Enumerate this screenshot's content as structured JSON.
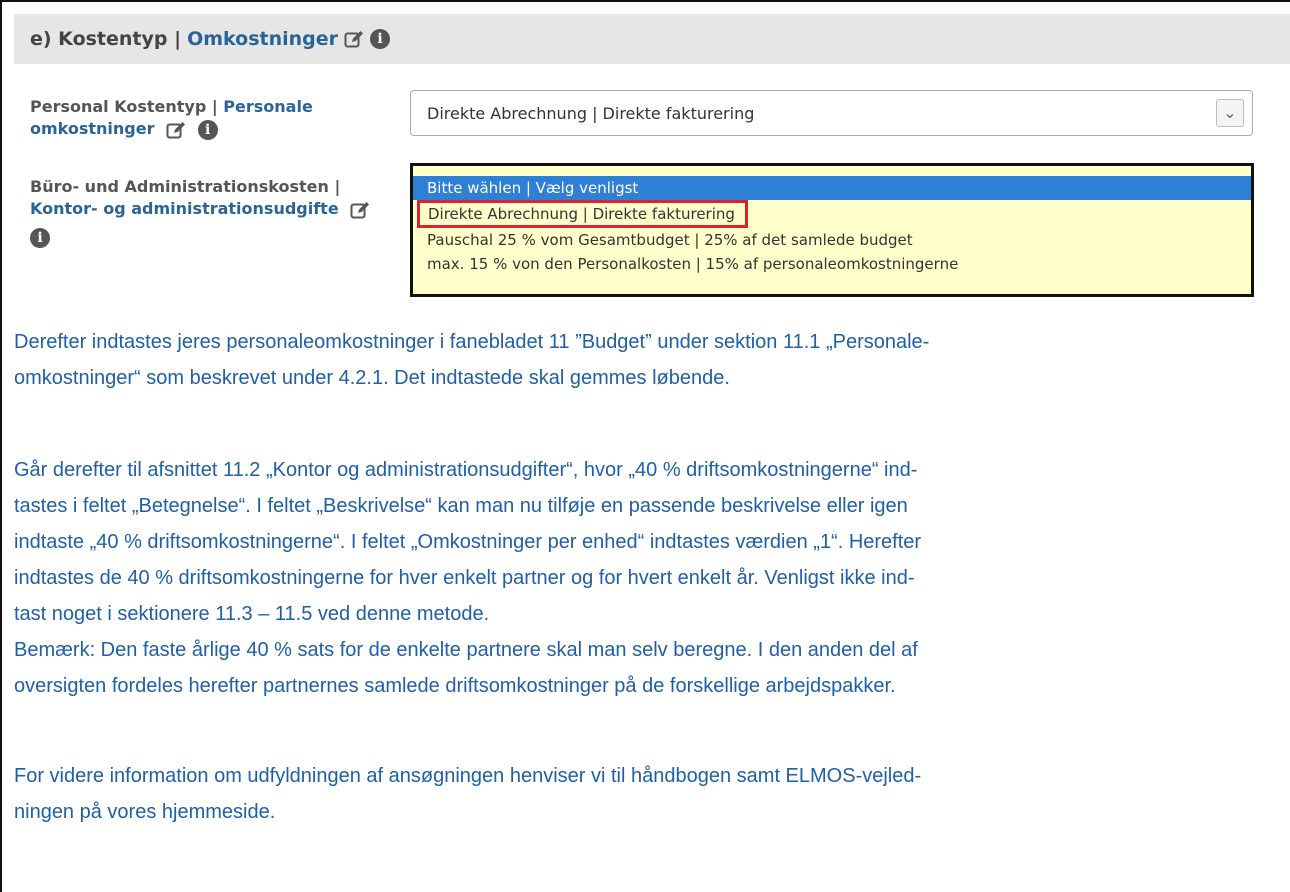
{
  "header": {
    "prefix": "e) Kostentyp |",
    "link": "Omkostninger"
  },
  "fields": {
    "personal": {
      "label_plain": "Personal Kostentyp |",
      "label_link": "Personale omkostninger"
    },
    "buero": {
      "label_plain": "Büro- und Administrationskosten |",
      "label_link": "Kontor- og administrationsudgifte"
    }
  },
  "select": {
    "value": "Direkte Abrechnung | Direkte fakturering"
  },
  "dropdown": {
    "options": [
      "Bitte wählen | Vælg venligst",
      "Direkte Abrechnung | Direkte fakturering",
      "Pauschal 25 % vom Gesamtbudget | 25% af det samlede budget",
      "max. 15 % von den Personalkosten | 15% af personaleomkostningerne"
    ]
  },
  "body": {
    "p1_l1": "Derefter indtastes jeres personaleomkostninger i fanebladet 11 ”Budget” under sektion 11.1 „Personale-",
    "p1_l2": "omkostninger“ som beskrevet under 4.2.1. Det indtastede skal gemmes løbende.",
    "p2_l1": "Går derefter til afsnittet 11.2 „Kontor og administrationsudgifter“, hvor „40 % driftsomkostningerne“ ind-",
    "p2_l2": "tastes i feltet „Betegnelse“. I feltet „Beskrivelse“ kan man nu tilføje en passende beskrivelse eller igen",
    "p2_l3": "indtaste „40 % driftsomkostningerne“. I feltet „Omkostninger per enhed“ indtastes værdien „1“. Herefter",
    "p2_l4": "indtastes de 40 % driftsomkostningerne for hver enkelt partner og for hvert enkelt år. Venligst ikke ind-",
    "p2_l5": "tast noget i sektionere 11.3 – 11.5 ved denne metode.",
    "p2_l6": "Bemærk: Den faste årlige 40 % sats for de enkelte partnere skal man selv beregne. I den anden del af",
    "p2_l7": "oversigten fordeles herefter partnernes samlede driftsomkostninger på de forskellige arbejdspakker.",
    "p3_l1": "For videre information om udfyldningen af ansøgningen henviser vi til håndbogen samt ELMOS-vejled-",
    "p3_l2": "ningen på vores hjemmeside."
  }
}
